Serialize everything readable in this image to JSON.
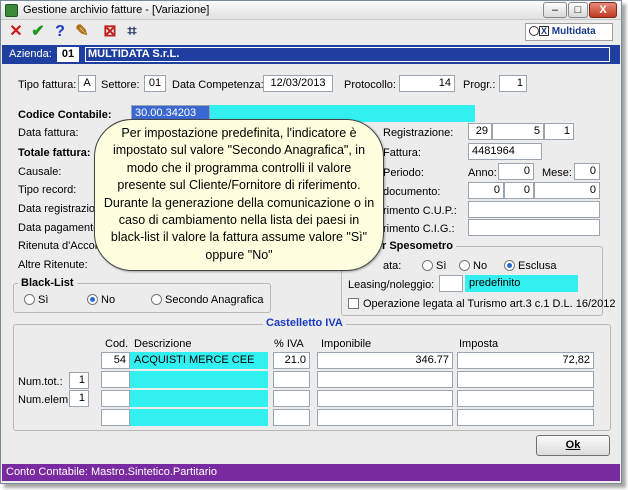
{
  "window": {
    "title": "Gestione archivio fatture - [Variazione]"
  },
  "titlebar_buttons": {
    "minimize": "–",
    "maximize": "□",
    "close": "X"
  },
  "toolbar": {
    "icons": [
      "cancel-icon",
      "confirm-icon",
      "help-icon",
      "settings-icon",
      "delete-icon",
      "binoculars-icon"
    ],
    "glyphs": {
      "cancel": "✕",
      "confirm": "✔",
      "help": "?",
      "settings": "✎",
      "delete": "⊠",
      "binoculars": "⌗"
    },
    "brand": "Multidata",
    "brand_box": "X"
  },
  "azienda": {
    "label": "Azienda:",
    "code": "01",
    "name": "MULTIDATA S.r.L."
  },
  "header_row": {
    "tipo_fattura_label": "Tipo fattura:",
    "tipo_fattura": "A",
    "settore_label": "Settore:",
    "settore": "01",
    "data_competenza_label": "Data Competenza:",
    "data_competenza": "12/03/2013",
    "protocollo_label": "Protocollo:",
    "protocollo": "14",
    "progr_label": "Progr.:",
    "progr": "1"
  },
  "form": {
    "codice_contabile_label": "Codice Contabile:",
    "codice_contabile": "30.00.34203",
    "data_fattura_label": "Data fattura:",
    "totale_fattura_label": "Totale fattura:",
    "causale_label": "Causale:",
    "tipo_record_label": "Tipo record:",
    "data_registrazione_label": "Data registrazione",
    "data_pagamento_label": "Data pagamento",
    "ritenuta_label": "Ritenuta d'Acconto",
    "altre_ritenute_label": "Altre Ritenute:",
    "registrazione_label": "Registrazione:",
    "registrazione": [
      "29",
      "5",
      "1"
    ],
    "fattura_label": "Fattura:",
    "fattura": "4481964",
    "periodo_label": "Periodo:",
    "anno_label": "Anno:",
    "anno": "0",
    "mese_label": "Mese:",
    "mese": "0",
    "documento_label": "documento:",
    "documento": [
      "0",
      "0",
      "0"
    ],
    "cup_label": "rimento C.U.P.:",
    "cig_label": "rimento C.I.G.:"
  },
  "spesometro": {
    "title": "r Spesometro",
    "row_label": "ata:",
    "options": [
      "Sì",
      "No",
      "Esclusa"
    ],
    "selected": "Esclusa",
    "leasing_label": "Leasing/noleggio:",
    "leasing_value": "predefinito",
    "turismo_label": "Operazione legata al Turismo art.3 c.1 D.L. 16/2012"
  },
  "blacklist": {
    "title": "Black-List",
    "options": [
      "Sì",
      "No",
      "Secondo Anagrafica"
    ],
    "selected": "No"
  },
  "tooltip": {
    "text": "Per impostazione predefinita, l'indicatore è impostato sul valore \"Secondo Anagrafica\", in modo che il programma controlli il valore presente sul Cliente/Fornitore di riferimento. Durante la generazione della comunicazione o in caso di cambiamento nella lista dei paesi in black-list il valore la fattura assume valore \"Sì\" oppure \"No\""
  },
  "castelletto": {
    "title": "Castelletto IVA",
    "headers": {
      "cod": "Cod.",
      "descrizione": "Descrizione",
      "iva": "% IVA",
      "imponibile": "Imponibile",
      "imposta": "Imposta"
    },
    "rows": [
      {
        "cod": "54",
        "descrizione": "ACQUISTI MERCE CEE",
        "iva": "21.0",
        "imponibile": "346.77",
        "imposta": "72,82"
      },
      {
        "cod": "",
        "descrizione": "",
        "iva": "",
        "imponibile": "",
        "imposta": ""
      },
      {
        "cod": "",
        "descrizione": "",
        "iva": "",
        "imponibile": "",
        "imposta": ""
      },
      {
        "cod": "",
        "descrizione": "",
        "iva": "",
        "imponibile": "",
        "imposta": ""
      }
    ],
    "num_tot_label": "Num.tot.:",
    "num_tot": "1",
    "num_elem_label": "Num.elem.:",
    "num_elem": "1"
  },
  "ok_label": "Ok",
  "statusbar": "Conto Contabile: Mastro.Sintetico.Partitario"
}
